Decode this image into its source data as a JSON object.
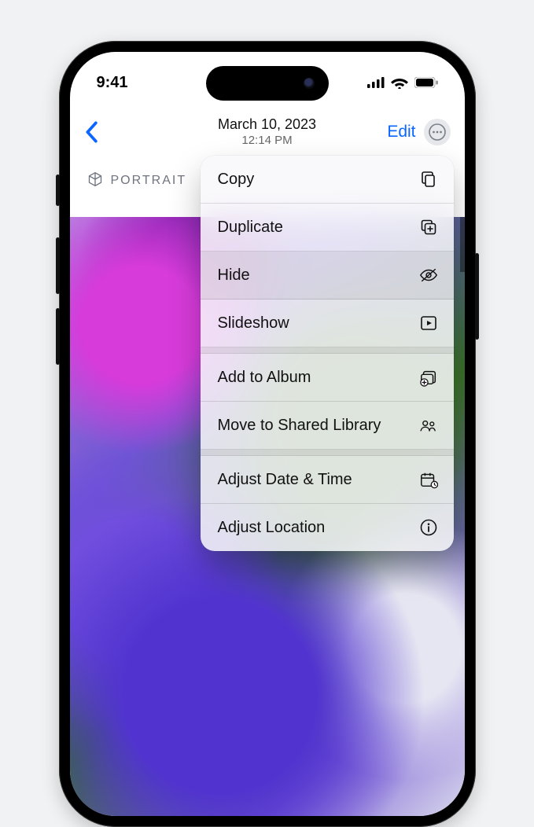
{
  "status": {
    "time": "9:41"
  },
  "nav": {
    "date": "March 10, 2023",
    "time": "12:14 PM",
    "edit_label": "Edit"
  },
  "badge": {
    "label": "PORTRAIT"
  },
  "menu": {
    "group1": [
      {
        "label": "Copy",
        "icon": "copy-icon"
      },
      {
        "label": "Duplicate",
        "icon": "duplicate-icon"
      },
      {
        "label": "Hide",
        "icon": "hide-icon",
        "highlight": true
      },
      {
        "label": "Slideshow",
        "icon": "slideshow-icon"
      }
    ],
    "group2": [
      {
        "label": "Add to Album",
        "icon": "add-to-album-icon"
      },
      {
        "label": "Move to Shared Library",
        "icon": "shared-library-icon"
      }
    ],
    "group3": [
      {
        "label": "Adjust Date & Time",
        "icon": "calendar-icon"
      },
      {
        "label": "Adjust Location",
        "icon": "info-icon"
      }
    ]
  }
}
